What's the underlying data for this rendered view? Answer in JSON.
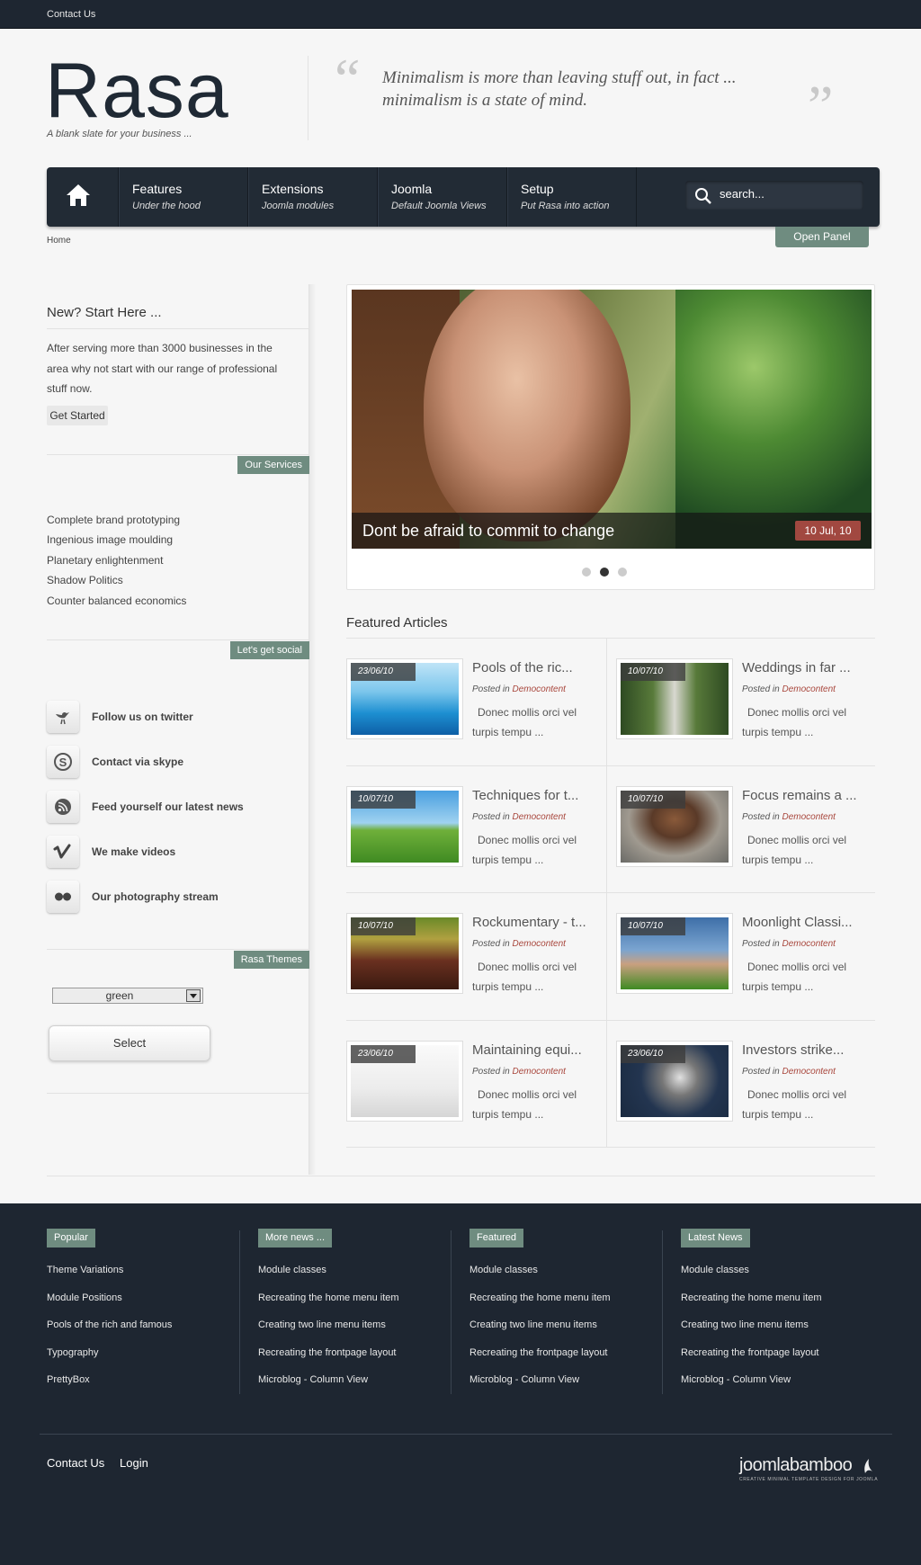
{
  "topbar": {
    "contact": "Contact Us"
  },
  "header": {
    "logo": "Rasa",
    "tagline": "A blank slate for your business ...",
    "quote": "Minimalism is more than leaving stuff out, in fact ... minimalism is a state of mind."
  },
  "nav": {
    "items": [
      {
        "title": "Features",
        "sub": "Under the hood"
      },
      {
        "title": "Extensions",
        "sub": "Joomla modules"
      },
      {
        "title": "Joomla",
        "sub": "Default Joomla Views"
      },
      {
        "title": "Setup",
        "sub": "Put Rasa into action"
      }
    ],
    "search_placeholder": "search..."
  },
  "breadcrumb": "Home",
  "open_panel": "Open Panel",
  "sidebar": {
    "start": {
      "heading": "New? Start Here ...",
      "text": "After serving more than 3000 businesses in the area why not start with our range of professional stuff now.",
      "button": "Get Started"
    },
    "services": {
      "tag": "Our Services",
      "items": [
        "Complete brand prototyping",
        "Ingenious image moulding",
        "Planetary enlightenment",
        "Shadow Politics",
        "Counter balanced economics"
      ]
    },
    "social": {
      "tag": "Let's get social",
      "items": [
        {
          "icon": "twitter-bird-icon",
          "label": "Follow us on twitter"
        },
        {
          "icon": "skype-icon",
          "label": "Contact via skype"
        },
        {
          "icon": "rss-icon",
          "label": "Feed yourself our latest news"
        },
        {
          "icon": "vimeo-icon",
          "label": "We make videos"
        },
        {
          "icon": "flickr-icon",
          "label": "Our photography stream"
        }
      ]
    },
    "themes": {
      "tag": "Rasa Themes",
      "selected": "green",
      "button": "Select"
    }
  },
  "slider": {
    "caption": "Dont be afraid to commit to change",
    "date": "10 Jul, 10",
    "active_dot": 2,
    "dots": 3
  },
  "featured": {
    "heading": "Featured Articles",
    "posted_in": "Posted in",
    "category": "Democontent",
    "excerpt": "Donec mollis orci vel turpis tempu ...",
    "articles": [
      {
        "date": "23/06/10",
        "title": "Pools of the ric...",
        "thumb": "pool"
      },
      {
        "date": "10/07/10",
        "title": "Weddings in far ...",
        "thumb": "wedding"
      },
      {
        "date": "10/07/10",
        "title": "Techniques for t...",
        "thumb": "golf"
      },
      {
        "date": "10/07/10",
        "title": "Focus remains a ...",
        "thumb": "runner"
      },
      {
        "date": "10/07/10",
        "title": "Rockumentary - t...",
        "thumb": "crowd"
      },
      {
        "date": "10/07/10",
        "title": "Moonlight Classi...",
        "thumb": "feet"
      },
      {
        "date": "23/06/10",
        "title": "Maintaining equi...",
        "thumb": "room"
      },
      {
        "date": "23/06/10",
        "title": "Investors strike...",
        "thumb": "megaphone"
      }
    ]
  },
  "footer": {
    "columns": [
      {
        "tag": "Popular",
        "links": [
          "Theme Variations",
          "Module Positions",
          "Pools of the rich and famous",
          "Typography",
          "PrettyBox"
        ]
      },
      {
        "tag": "More news ...",
        "links": [
          "Module classes",
          "Recreating the home menu item",
          "Creating two line menu items",
          "Recreating the frontpage layout",
          "Microblog - Column View"
        ]
      },
      {
        "tag": "Featured",
        "links": [
          "Module classes",
          "Recreating the home menu item",
          "Creating two line menu items",
          "Recreating the frontpage layout",
          "Microblog - Column View"
        ]
      },
      {
        "tag": "Latest News",
        "links": [
          "Module classes",
          "Recreating the home menu item",
          "Creating two line menu items",
          "Recreating the frontpage layout",
          "Microblog - Column View"
        ]
      }
    ],
    "contact": "Contact Us",
    "login": "Login",
    "brand": "joomlabamboo",
    "brand_sub": "CREATIVE MINIMAL TEMPLATE DESIGN FOR JOOMLA"
  },
  "colors": {
    "accent": "#6f8c80",
    "dark": "#1e2631",
    "date_badge": "#a14840",
    "category": "#a8463c"
  }
}
